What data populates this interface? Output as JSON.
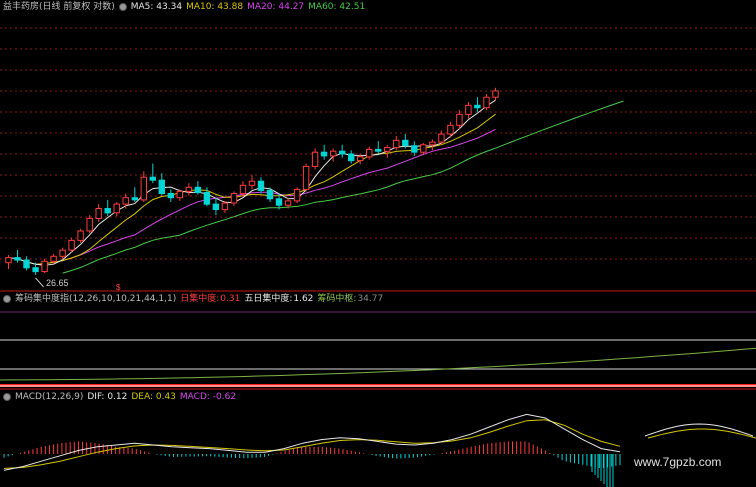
{
  "main": {
    "title": "益丰药房(日线 前复权 对数)",
    "ma5_label": "MA5: 43.34",
    "ma10_label": "MA10: 43.88",
    "ma20_label": "MA20: 44.27",
    "ma60_label": "MA60: 42.51",
    "low_label": "26.65",
    "marker": "$",
    "colors": {
      "up": "#ff3b3b",
      "down": "#00d5d5",
      "ma5": "#e8e8e8",
      "ma10": "#d6c600",
      "ma20": "#d946ef",
      "ma60": "#44cc44"
    }
  },
  "chip": {
    "title": "筹码集中度指(12,26,10,10,21,44,1,1)",
    "daily_label": "日集中度:",
    "daily_value": "0.31",
    "five_label": "五日集中度:",
    "five_value": "1.62",
    "center_label": "筹码中枢:",
    "center_value": "34.77"
  },
  "macd": {
    "title": "MACD(12,26,9)",
    "dif_label": "DIF: 0.12",
    "dea_label": "DEA: 0.43",
    "macd_label": "MACD: -0.62"
  },
  "watermark": "www.7gpzb.com",
  "chart_data": [
    {
      "type": "candlestick",
      "title": "益丰药房(日线 前复权 对数)",
      "note": "Values estimated from chart; no price axis visible. Low marked at 26.65.",
      "series": [
        {
          "name": "MA5",
          "last": 43.34
        },
        {
          "name": "MA10",
          "last": 43.88
        },
        {
          "name": "MA20",
          "last": 44.27
        },
        {
          "name": "MA60",
          "last": 42.51
        }
      ],
      "candles": [
        [
          27.6,
          28.2,
          27.1,
          28.0
        ],
        [
          28.0,
          28.6,
          27.6,
          27.8
        ],
        [
          27.8,
          28.1,
          27.0,
          27.2
        ],
        [
          27.2,
          27.6,
          26.65,
          26.9
        ],
        [
          26.9,
          27.9,
          26.8,
          27.7
        ],
        [
          27.7,
          28.3,
          27.5,
          28.1
        ],
        [
          28.1,
          28.8,
          27.9,
          28.6
        ],
        [
          28.6,
          29.6,
          28.4,
          29.4
        ],
        [
          29.4,
          30.4,
          29.2,
          30.2
        ],
        [
          30.2,
          31.6,
          30.0,
          31.3
        ],
        [
          31.3,
          32.6,
          31.0,
          32.2
        ],
        [
          32.2,
          33.0,
          31.5,
          31.8
        ],
        [
          31.8,
          32.8,
          31.5,
          32.6
        ],
        [
          32.6,
          33.6,
          32.2,
          33.2
        ],
        [
          33.2,
          34.2,
          32.8,
          33.0
        ],
        [
          33.0,
          35.8,
          32.8,
          35.2
        ],
        [
          35.2,
          36.6,
          34.6,
          34.9
        ],
        [
          34.9,
          35.6,
          33.4,
          33.6
        ],
        [
          33.6,
          34.0,
          32.8,
          33.2
        ],
        [
          33.2,
          34.0,
          32.9,
          33.8
        ],
        [
          33.8,
          34.6,
          33.4,
          34.2
        ],
        [
          34.2,
          34.8,
          33.5,
          33.7
        ],
        [
          33.7,
          34.2,
          32.4,
          32.6
        ],
        [
          32.6,
          33.2,
          31.6,
          32.1
        ],
        [
          32.1,
          32.9,
          31.8,
          32.7
        ],
        [
          32.7,
          33.8,
          32.4,
          33.6
        ],
        [
          33.6,
          34.8,
          33.3,
          34.4
        ],
        [
          34.4,
          35.4,
          34.0,
          34.8
        ],
        [
          34.8,
          35.2,
          33.6,
          33.9
        ],
        [
          33.9,
          34.2,
          32.8,
          33.1
        ],
        [
          33.1,
          33.6,
          32.1,
          32.5
        ],
        [
          32.5,
          33.2,
          32.2,
          32.9
        ],
        [
          32.9,
          34.2,
          32.7,
          34.0
        ],
        [
          34.0,
          36.6,
          33.8,
          36.3
        ],
        [
          36.3,
          38.2,
          36.0,
          37.8
        ],
        [
          37.8,
          38.6,
          37.0,
          37.4
        ],
        [
          37.4,
          38.2,
          36.8,
          37.9
        ],
        [
          37.9,
          38.6,
          37.2,
          37.6
        ],
        [
          37.6,
          38.0,
          36.6,
          36.9
        ],
        [
          36.9,
          37.6,
          36.5,
          37.3
        ],
        [
          37.3,
          38.4,
          37.0,
          38.1
        ],
        [
          38.1,
          39.0,
          37.6,
          37.9
        ],
        [
          37.9,
          38.6,
          37.2,
          38.3
        ],
        [
          38.3,
          39.6,
          38.0,
          39.1
        ],
        [
          39.1,
          39.8,
          38.2,
          38.5
        ],
        [
          38.5,
          39.0,
          37.4,
          37.8
        ],
        [
          37.8,
          38.8,
          37.5,
          38.6
        ],
        [
          38.6,
          39.2,
          38.0,
          38.9
        ],
        [
          38.9,
          40.2,
          38.6,
          39.8
        ],
        [
          39.8,
          41.2,
          39.4,
          40.8
        ],
        [
          40.8,
          42.6,
          40.4,
          42.1
        ],
        [
          42.1,
          43.6,
          41.6,
          43.2
        ],
        [
          43.2,
          44.2,
          42.4,
          42.9
        ],
        [
          42.9,
          44.6,
          42.6,
          44.2
        ],
        [
          44.2,
          45.4,
          43.8,
          45.0
        ]
      ]
    },
    {
      "type": "line",
      "title": "筹码集中度指(12,26,10,10,21,44,1,1)",
      "series": [
        {
          "name": "日集中度",
          "last": 0.31
        },
        {
          "name": "五日集中度",
          "last": 1.62
        },
        {
          "name": "筹码中枢",
          "last": 34.77
        }
      ]
    },
    {
      "type": "line",
      "title": "MACD(12,26,9)",
      "series": [
        {
          "name": "DIF",
          "last": 0.12,
          "values": [
            -0.9,
            -0.7,
            -0.4,
            -0.1,
            0.2,
            0.4,
            0.5,
            0.6,
            0.5,
            0.4,
            0.35,
            0.3,
            0.2,
            0.1,
            0.1,
            0.3,
            0.6,
            0.8,
            0.9,
            0.85,
            0.7,
            0.55,
            0.5,
            0.6,
            0.8,
            1.1,
            1.5,
            1.9,
            2.2,
            2.0,
            1.4,
            0.8,
            0.3,
            0.12
          ]
        },
        {
          "name": "DEA",
          "last": 0.43,
          "values": [
            -0.8,
            -0.75,
            -0.6,
            -0.4,
            -0.15,
            0.1,
            0.3,
            0.45,
            0.5,
            0.48,
            0.42,
            0.36,
            0.3,
            0.22,
            0.18,
            0.22,
            0.4,
            0.6,
            0.75,
            0.8,
            0.76,
            0.68,
            0.6,
            0.62,
            0.72,
            0.9,
            1.2,
            1.55,
            1.85,
            1.9,
            1.6,
            1.1,
            0.7,
            0.43
          ]
        },
        {
          "name": "MACD",
          "last": -0.62
        }
      ]
    }
  ]
}
